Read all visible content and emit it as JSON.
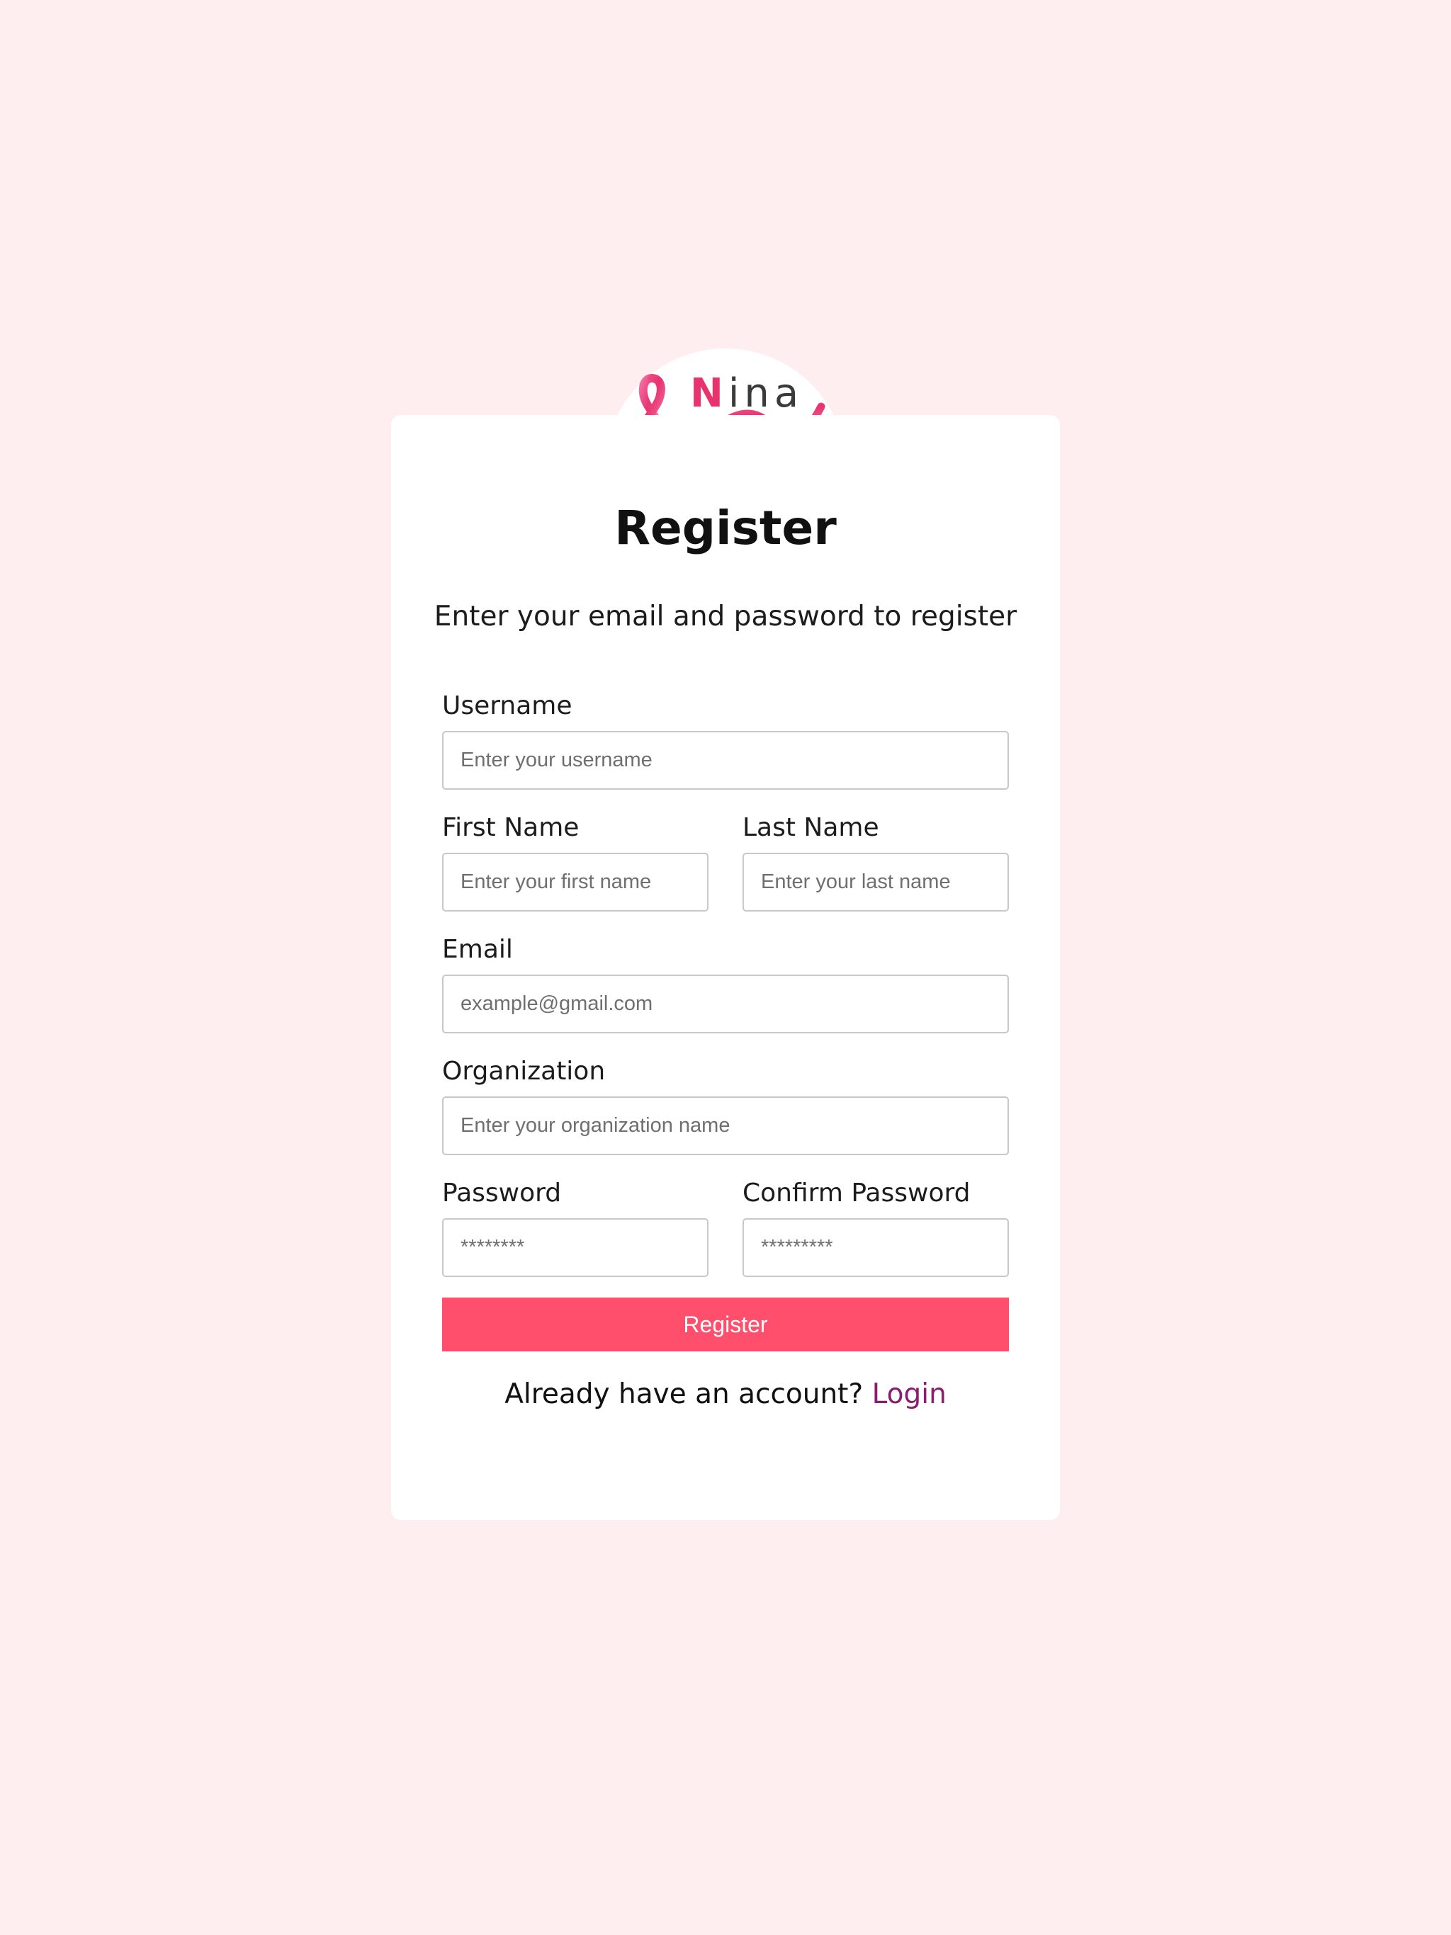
{
  "brand": {
    "name_initial": "N",
    "name_rest": "ina",
    "ribbon_color": "#e8336f"
  },
  "form": {
    "title": "Register",
    "subtitle": "Enter your email and password to register",
    "fields": {
      "username": {
        "label": "Username",
        "placeholder": "Enter your username"
      },
      "first_name": {
        "label": "First Name",
        "placeholder": "Enter your first name"
      },
      "last_name": {
        "label": "Last Name",
        "placeholder": "Enter your last name"
      },
      "email": {
        "label": "Email",
        "placeholder": "example@gmail.com"
      },
      "organization": {
        "label": "Organization",
        "placeholder": "Enter your organization name"
      },
      "password": {
        "label": "Password",
        "placeholder": "********"
      },
      "confirm_password": {
        "label": "Confirm Password",
        "placeholder": "*********"
      }
    },
    "submit_label": "Register",
    "footer_text": "Already have an account?",
    "login_link": "Login"
  },
  "colors": {
    "page_background": "#ffeeef",
    "accent": "#ff4f6d",
    "link": "#8b1d6f"
  }
}
